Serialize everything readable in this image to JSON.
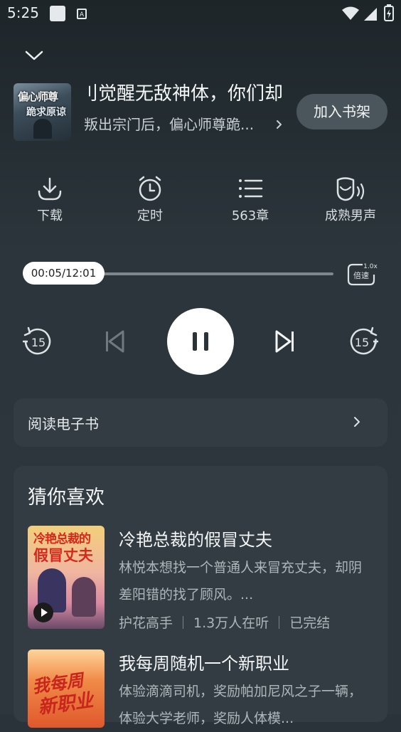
{
  "status_bar": {
    "time": "5:25",
    "icons": [
      "notification-square-icon",
      "a-badge-icon",
      "wifi-icon",
      "signal-icon",
      "battery-icon"
    ]
  },
  "header": {
    "collapse_icon": "chevron-down-icon"
  },
  "book": {
    "cover_text_1": "偏心师尊",
    "cover_text_2": "跪求原谅",
    "title": "刂觉醒无敌神体，你们却",
    "subtitle": "叛出宗门后，偏心师尊跪...",
    "add_to_shelf": "加入书架"
  },
  "actions": [
    {
      "icon": "download-icon",
      "label": "下载"
    },
    {
      "icon": "alarm-clock-icon",
      "label": "定时"
    },
    {
      "icon": "chapter-list-icon",
      "label": "563章"
    },
    {
      "icon": "voice-icon",
      "label": "成熟男声"
    }
  ],
  "player": {
    "time_display": "00:05/12:01",
    "progress_fraction": 0.007,
    "speed_badge": "1.0x",
    "speed_label": "倍速",
    "rewind_label": "15",
    "forward_label": "15"
  },
  "ebook": {
    "label": "阅读电子书"
  },
  "recommend": {
    "title": "猜你喜欢",
    "items": [
      {
        "cover_line1": "冷艳总裁的",
        "cover_line2": "假冒丈夫",
        "title": "冷艳总裁的假冒丈夫",
        "desc": "林悦本想找一个普通人来冒充丈夫，却阴差阳错的找了顾风。...",
        "author": "护花高手",
        "listeners": "1.3万人在听",
        "status": "已完结"
      },
      {
        "cover_line1": "我每周",
        "cover_line2": "新职业",
        "title": "我每周随机一个新职业",
        "desc": "体验滴滴司机，奖励帕加尼风之子一辆，体验大学老师，奖励人体模..."
      }
    ]
  },
  "colors": {
    "background": "#2a3339",
    "card": "#323c42",
    "accent_button": "#4a555c",
    "text_primary": "#f3f5f6",
    "text_secondary": "#aeb6bb"
  }
}
